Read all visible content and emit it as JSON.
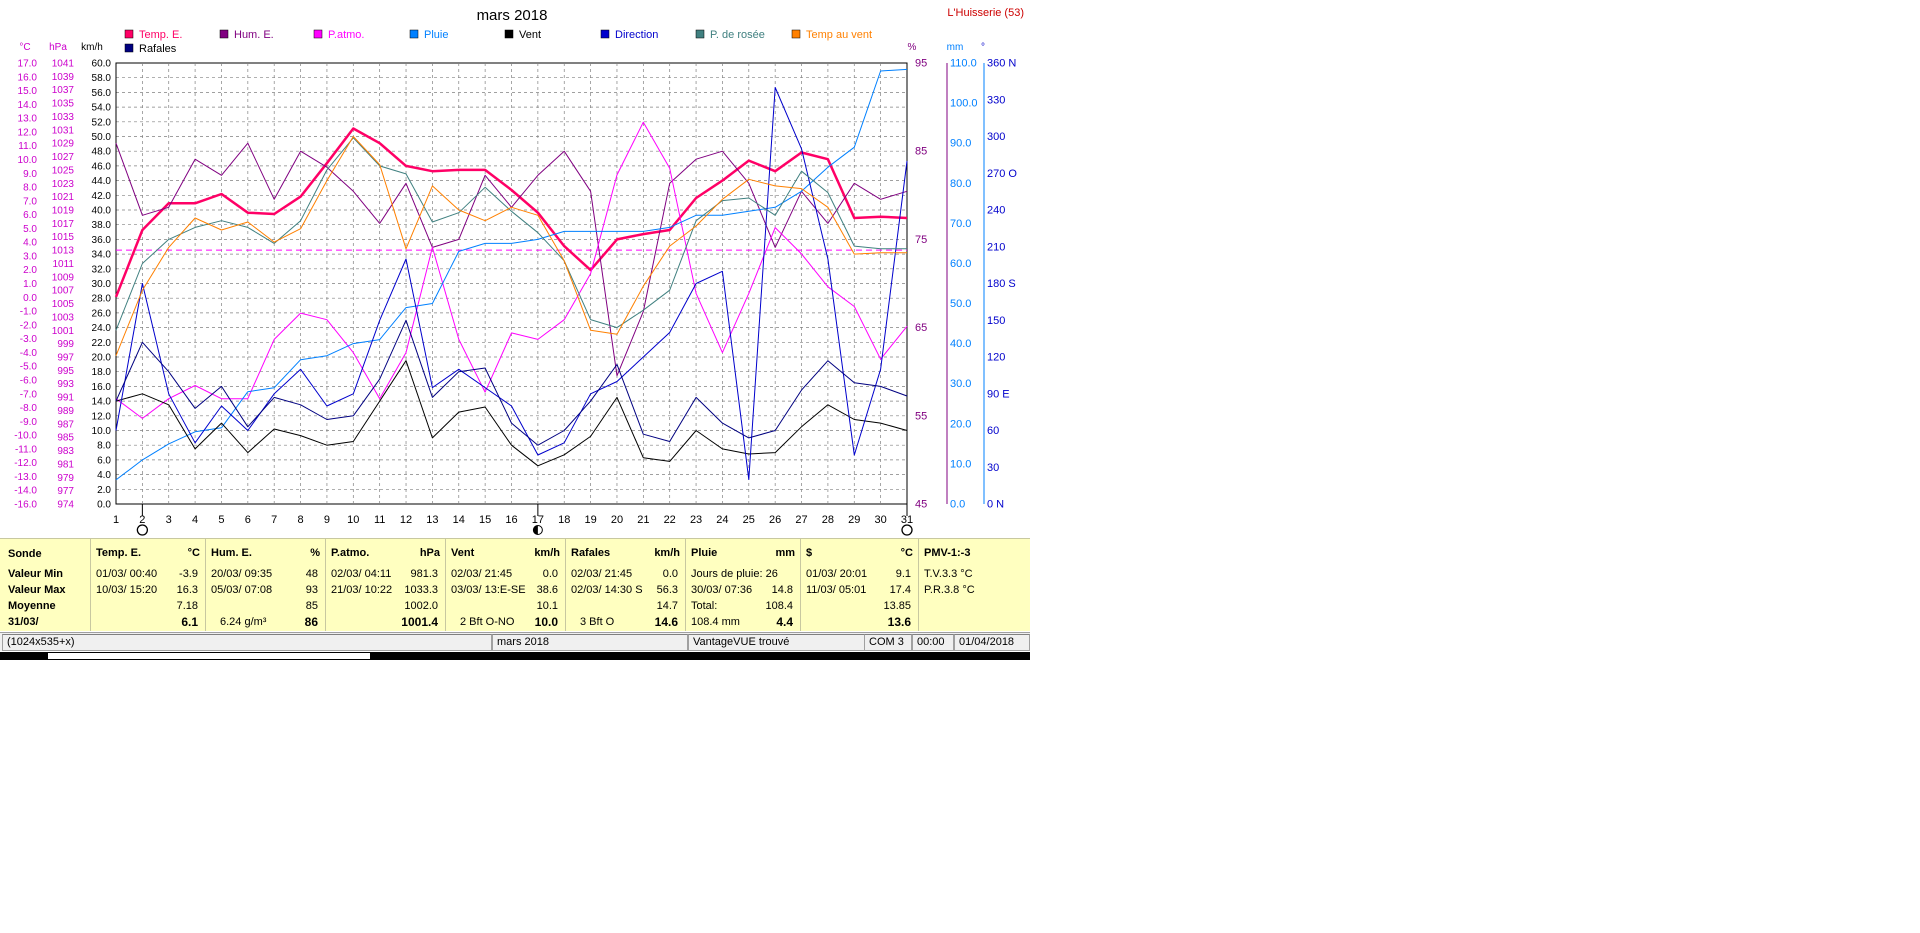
{
  "chart_data": {
    "type": "line",
    "title": "mars 2018",
    "location": "L'Huisserie (53)",
    "x": [
      1,
      2,
      3,
      4,
      5,
      6,
      7,
      8,
      9,
      10,
      11,
      12,
      13,
      14,
      15,
      16,
      17,
      18,
      19,
      20,
      21,
      22,
      23,
      24,
      25,
      26,
      27,
      28,
      29,
      30,
      31
    ],
    "x_ticks": [
      "1",
      "2",
      "3",
      "4",
      "5",
      "6",
      "7",
      "8",
      "9",
      "10",
      "11",
      "12",
      "13",
      "14",
      "15",
      "16",
      "17",
      "18",
      "19",
      "20",
      "21",
      "22",
      "23",
      "24",
      "25",
      "26",
      "27",
      "28",
      "29",
      "30",
      "31"
    ],
    "axes": {
      "temp": {
        "label": "°C",
        "min": -16,
        "max": 17,
        "color": "#cc00cc",
        "ticks": [
          "17.0",
          "16.0",
          "15.0",
          "14.0",
          "13.0",
          "12.0",
          "11.0",
          "10.0",
          "9.0",
          "8.0",
          "7.0",
          "6.0",
          "5.0",
          "4.0",
          "3.0",
          "2.0",
          "1.0",
          "0.0",
          "-1.0",
          "-2.0",
          "-3.0",
          "-4.0",
          "-5.0",
          "-6.0",
          "-7.0",
          "-8.0",
          "-9.0",
          "-10.0",
          "-11.0",
          "-12.0",
          "-13.0",
          "-14.0",
          "-16.0"
        ]
      },
      "pressure": {
        "label": "hPa",
        "min": 974,
        "max": 1041,
        "color": "#cc00cc",
        "ticks": [
          "1041",
          "1039",
          "1037",
          "1035",
          "1033",
          "1031",
          "1029",
          "1027",
          "1025",
          "1023",
          "1021",
          "1019",
          "1017",
          "1015",
          "1013",
          "1011",
          "1009",
          "1007",
          "1005",
          "1003",
          "1001",
          "999",
          "997",
          "995",
          "993",
          "991",
          "989",
          "987",
          "985",
          "983",
          "981",
          "979",
          "977",
          "974"
        ]
      },
      "wind": {
        "label": "km/h",
        "min": 0,
        "max": 60,
        "color": "#000000",
        "ticks": [
          "60.0",
          "58.0",
          "56.0",
          "54.0",
          "52.0",
          "50.0",
          "48.0",
          "46.0",
          "44.0",
          "42.0",
          "40.0",
          "38.0",
          "36.0",
          "34.0",
          "32.0",
          "30.0",
          "28.0",
          "26.0",
          "24.0",
          "22.0",
          "20.0",
          "18.0",
          "16.0",
          "14.0",
          "12.0",
          "10.0",
          "8.0",
          "6.0",
          "4.0",
          "2.0",
          "0.0"
        ]
      },
      "hum": {
        "label": "%",
        "min": 45,
        "max": 100,
        "color": "#800080",
        "ticks": [
          "95",
          "85",
          "75",
          "65",
          "55",
          "45"
        ]
      },
      "rain": {
        "label": "mm",
        "min": 0,
        "max": 110,
        "color": "#0080ff",
        "ticks": [
          "110.0",
          "100.0",
          "90.0",
          "80.0",
          "70.0",
          "60.0",
          "50.0",
          "40.0",
          "30.0",
          "20.0",
          "10.0",
          "0.0"
        ]
      },
      "dir": {
        "label": "°",
        "min": 0,
        "max": 360,
        "color": "#0000cc",
        "ticks": [
          "360 N",
          "330",
          "300",
          "270 O",
          "240",
          "210",
          "180 S",
          "150",
          "120",
          "90  E",
          "60",
          "30",
          "0   N"
        ]
      }
    },
    "legend": [
      "Temp. E.",
      "Hum. E.",
      "P.atmo.",
      "Pluie",
      "Vent",
      "Direction",
      "P. de rosée",
      "Temp au vent",
      "Rafales"
    ],
    "series": [
      {
        "name": "Temp. E.",
        "axis": "temp",
        "color": "#ff0066",
        "width": 2.5,
        "values": [
          -0.5,
          4.5,
          6.5,
          6.5,
          7.2,
          5.8,
          5.7,
          7.0,
          9.5,
          12.1,
          11.0,
          9.3,
          8.9,
          9.0,
          9.0,
          7.5,
          5.8,
          3.3,
          1.5,
          3.8,
          4.2,
          4.5,
          6.9,
          8.2,
          9.7,
          8.9,
          10.3,
          9.8,
          5.4,
          5.5,
          5.4
        ]
      },
      {
        "name": "Hum. E.",
        "axis": "hum",
        "color": "#800080",
        "width": 1,
        "values": [
          90,
          81,
          82,
          88,
          86,
          90,
          83,
          89,
          87,
          84,
          80,
          85,
          77,
          78,
          86,
          82,
          86,
          89,
          84,
          61,
          69,
          85,
          88,
          89,
          85,
          77,
          84,
          80,
          85,
          83,
          84
        ]
      },
      {
        "name": "P.atmo.",
        "axis": "pressure",
        "color": "#ff00ff",
        "width": 1,
        "values": [
          990,
          987,
          990,
          992,
          990,
          990,
          999,
          1003,
          1002,
          997,
          990,
          997,
          1013,
          999,
          991,
          1000,
          999,
          1002,
          1009,
          1024,
          1032,
          1025,
          1006,
          997,
          1006,
          1016,
          1012,
          1007,
          1004,
          996,
          1001
        ]
      },
      {
        "name": "Pluie",
        "axis": "rain",
        "color": "#0080ff",
        "width": 1,
        "values": [
          6,
          11,
          15,
          18,
          19,
          28,
          29,
          36,
          37,
          40,
          41,
          49,
          50,
          63,
          65,
          65,
          66,
          68,
          68,
          68,
          68,
          69,
          72,
          72,
          73,
          74,
          78,
          84,
          89,
          108,
          108.4
        ]
      },
      {
        "name": "Vent",
        "axis": "wind",
        "color": "#000000",
        "width": 1,
        "values": [
          14,
          15,
          13.5,
          7.5,
          11,
          7,
          10.2,
          9.3,
          8,
          8.5,
          14,
          19.5,
          9,
          12.5,
          13.2,
          8,
          5.2,
          6.7,
          9.2,
          14.5,
          6.3,
          5.8,
          10,
          7.5,
          6.8,
          7,
          10.5,
          13.5,
          11.5,
          11,
          10
        ]
      },
      {
        "name": "Direction",
        "axis": "dir",
        "color": "#0000cc",
        "width": 1,
        "values": [
          60,
          180,
          90,
          50,
          80,
          60,
          90,
          110,
          80,
          90,
          150,
          200,
          95,
          110,
          95,
          80,
          40,
          50,
          90,
          100,
          120,
          140,
          180,
          190,
          20,
          340,
          290,
          200,
          40,
          110,
          280
        ]
      },
      {
        "name": "P. de rosée",
        "axis": "temp",
        "color": "#408080",
        "width": 1,
        "values": [
          -3,
          2,
          3.8,
          4.7,
          5.2,
          4.7,
          3.5,
          5.2,
          9.0,
          11.4,
          9.3,
          8.7,
          5.1,
          5.8,
          7.7,
          5.9,
          4.3,
          2.2,
          -2.2,
          -2.8,
          -1.5,
          0,
          5.2,
          6.7,
          6.9,
          5.6,
          8.9,
          7.3,
          3.3,
          3.1,
          3.1
        ]
      },
      {
        "name": "Temp au vent",
        "axis": "temp",
        "color": "#ff8000",
        "width": 1,
        "values": [
          -4.9,
          0,
          3.2,
          5.4,
          4.5,
          5.1,
          3.6,
          4.6,
          8.2,
          11.5,
          9.4,
          3.1,
          7.8,
          6.0,
          5.2,
          6.2,
          5.6,
          2.2,
          -3.0,
          -3.3,
          0.3,
          3.3,
          4.8,
          6.8,
          8.3,
          7.8,
          7.6,
          6.2,
          2.7,
          2.8,
          2.8
        ]
      },
      {
        "name": "Rafales",
        "axis": "wind",
        "color": "#000080",
        "width": 1,
        "values": [
          14,
          22,
          18,
          13,
          16,
          10.5,
          14.5,
          13.5,
          11.5,
          12,
          17,
          25,
          14.5,
          18,
          18.5,
          11,
          8,
          10,
          14,
          19,
          9.5,
          8.5,
          14.5,
          11,
          9,
          10,
          15.5,
          19.5,
          16.5,
          16,
          14.7
        ]
      }
    ],
    "reference_lines": [
      {
        "axis": "temp",
        "value": 3.0,
        "color": "#ff00ff",
        "style": "dashed"
      }
    ],
    "moon_phases": [
      {
        "day": 2,
        "phase": "new"
      },
      {
        "day": 17,
        "phase": "full"
      },
      {
        "day": 31,
        "phase": "new"
      }
    ],
    "grid": true
  },
  "table": {
    "row_labels": [
      "Sonde",
      "Valeur Min",
      "Valeur Max",
      "Moyenne",
      "31/03/"
    ],
    "columns": [
      {
        "title": "Temp. E.",
        "unit": "°C",
        "rows": [
          [
            "01/03/  00:40",
            "-3.9"
          ],
          [
            "10/03/  15:20",
            "16.3"
          ],
          [
            "",
            "7.18"
          ],
          [
            "",
            "6.1"
          ]
        ]
      },
      {
        "title": "Hum. E.",
        "unit": "%",
        "rows": [
          [
            "20/03/  09:35",
            "48"
          ],
          [
            "05/03/  07:08",
            "93"
          ],
          [
            "",
            "85"
          ],
          [
            "6.24 g/m³",
            "86"
          ]
        ]
      },
      {
        "title": "P.atmo.",
        "unit": "hPa",
        "rows": [
          [
            "02/03/  04:11",
            "981.3"
          ],
          [
            "21/03/  10:22",
            "1033.3"
          ],
          [
            "",
            "1002.0"
          ],
          [
            "",
            "1001.4"
          ]
        ]
      },
      {
        "title": "Vent",
        "unit": "km/h",
        "rows": [
          [
            "02/03/  21:45",
            "0.0"
          ],
          [
            "03/03/  13:E-SE",
            "38.6"
          ],
          [
            "",
            "10.1"
          ],
          [
            "2 Bft O-NO",
            "10.0"
          ]
        ]
      },
      {
        "title": "Rafales",
        "unit": "km/h",
        "rows": [
          [
            "02/03/  21:45",
            "0.0"
          ],
          [
            "02/03/  14:30   S",
            "56.3"
          ],
          [
            "",
            "14.7"
          ],
          [
            "3 Bft O",
            "14.6"
          ]
        ]
      },
      {
        "title": "Pluie",
        "unit": "mm",
        "rows": [
          [
            "Jours de pluie: 26",
            ""
          ],
          [
            "30/03/  07:36",
            "14.8"
          ],
          [
            "Total:",
            "108.4"
          ],
          [
            "108.4 mm",
            "4.4"
          ]
        ]
      },
      {
        "title": "$",
        "unit": "°C",
        "rows": [
          [
            "01/03/  20:01",
            "9.1"
          ],
          [
            "11/03/  05:01",
            "17.4"
          ],
          [
            "",
            "13.85"
          ],
          [
            "",
            "13.6"
          ]
        ]
      },
      {
        "title": "PMV-1:-3",
        "unit": "",
        "rows": [
          [
            "T.V.3.3 °C",
            ""
          ],
          [
            "P.R.3.8 °C",
            ""
          ],
          [
            "",
            ""
          ],
          [
            "",
            ""
          ]
        ]
      }
    ]
  },
  "status": {
    "size": "(1024x535+x)",
    "month": "mars 2018",
    "station": "VantageVUE trouvé",
    "port": "COM 3",
    "time": "00:00",
    "date": "01/04/2018"
  }
}
